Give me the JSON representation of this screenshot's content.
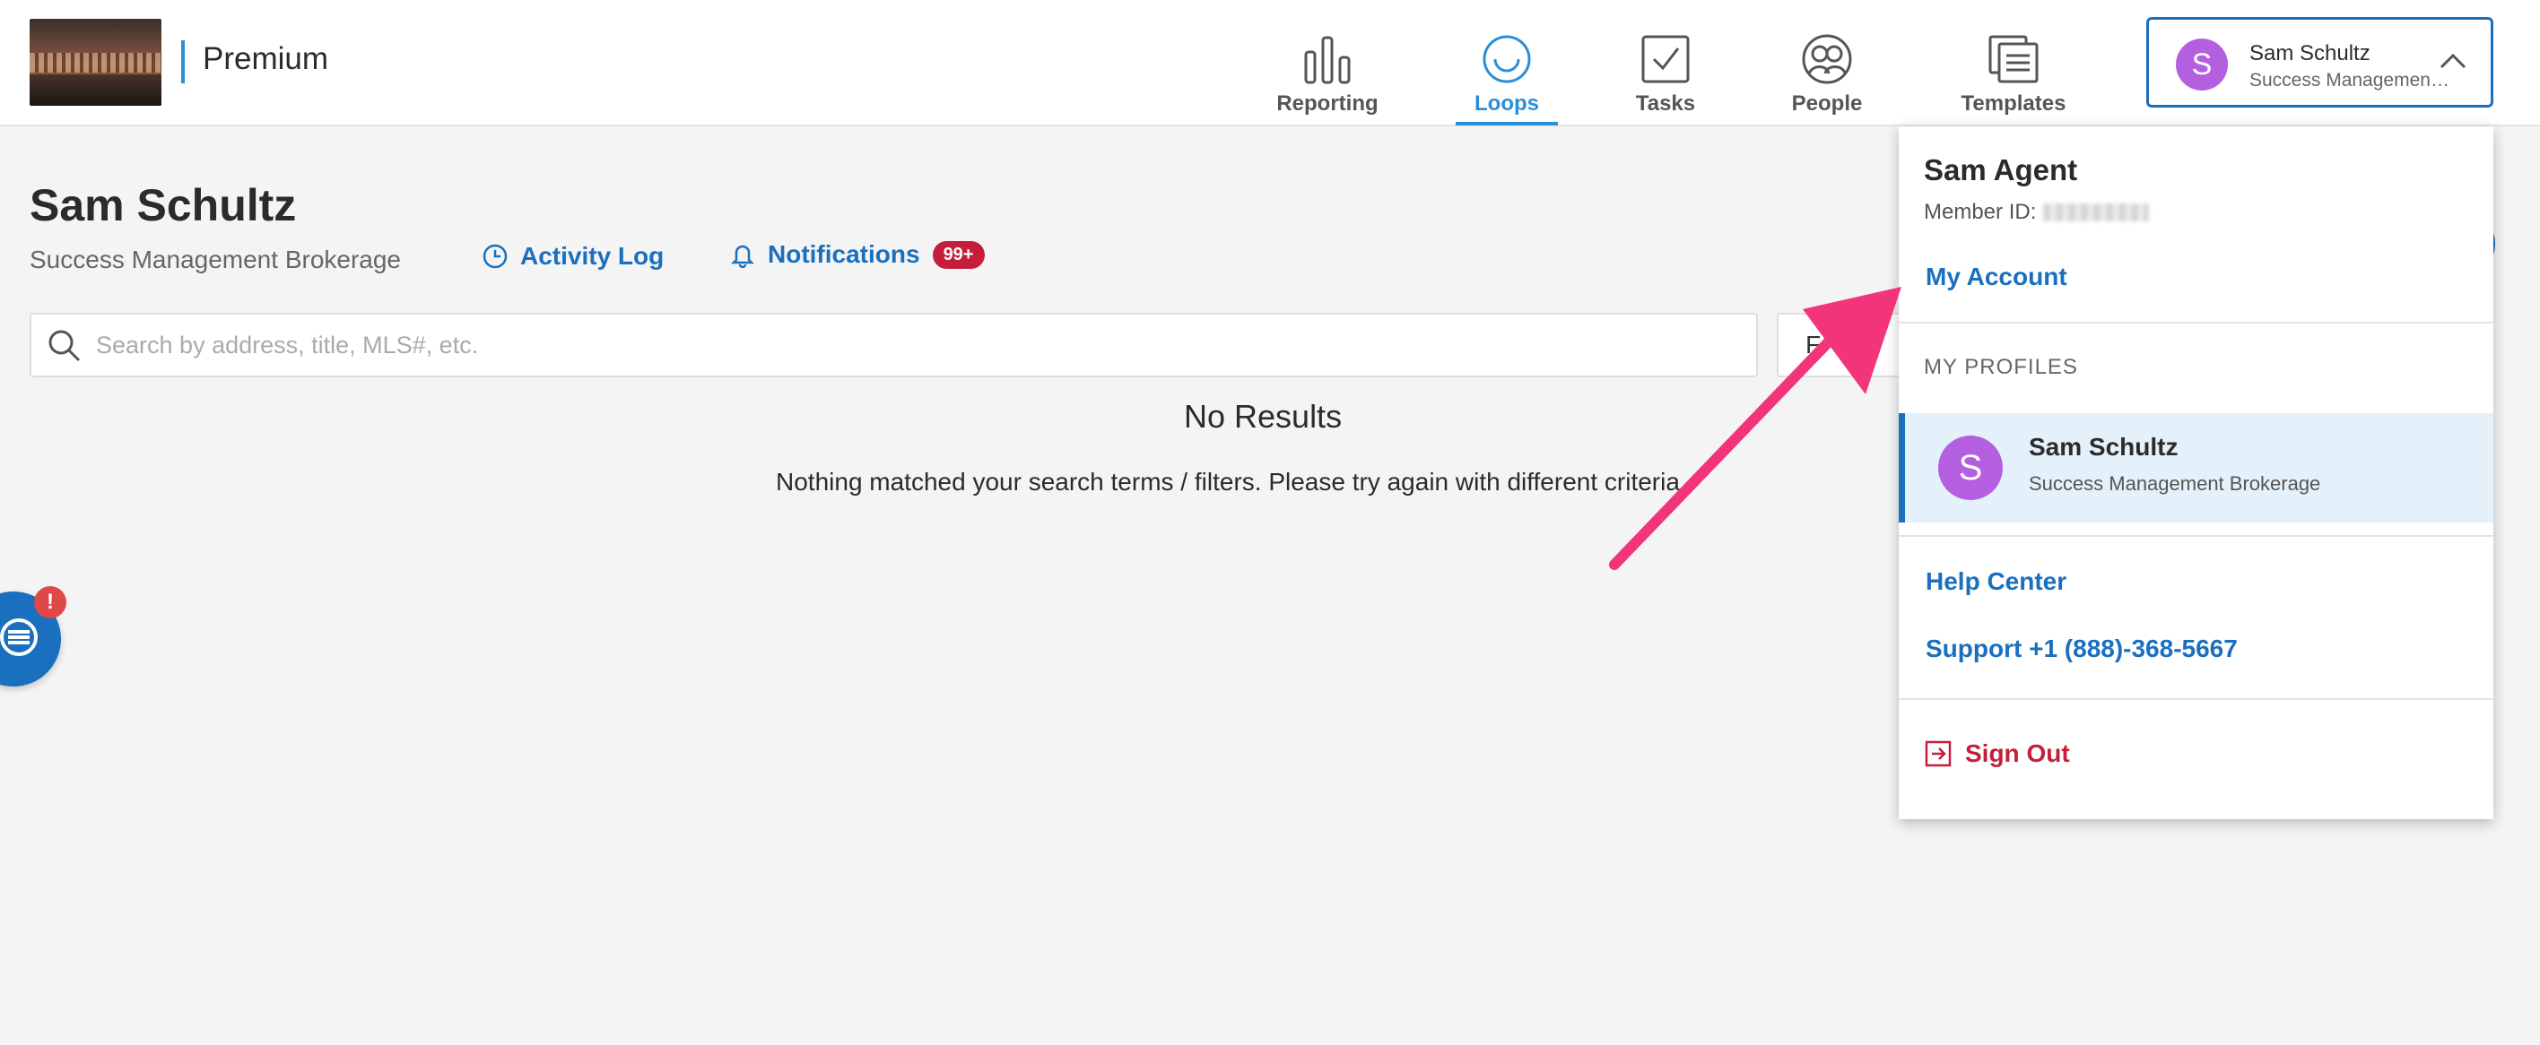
{
  "header": {
    "brand": "Premium",
    "nav": [
      {
        "label": "Reporting",
        "icon": "bar-chart-icon"
      },
      {
        "label": "Loops",
        "icon": "loop-icon",
        "active": true
      },
      {
        "label": "Tasks",
        "icon": "checkbox-icon"
      },
      {
        "label": "People",
        "icon": "people-icon"
      },
      {
        "label": "Templates",
        "icon": "templates-icon"
      }
    ],
    "account": {
      "initial": "S",
      "name": "Sam Schultz",
      "org": "Success Management Brokerage"
    }
  },
  "main": {
    "title": "Sam Schultz",
    "subtitle": "Success Management Brokerage",
    "activity_log": "Activity Log",
    "notifications": "Notifications",
    "notifications_badge": "99+",
    "search_placeholder": "Search by address, title, MLS#, etc.",
    "filter_initial": "F",
    "no_results_title": "No Results",
    "no_results_message": "Nothing matched your search terms / filters. Please try again with different criteria."
  },
  "chat": {
    "badge": "!"
  },
  "dropdown": {
    "name": "Sam Agent",
    "member_label": "Member ID:",
    "my_account": "My Account",
    "profiles_heading": "MY PROFILES",
    "profile": {
      "initial": "S",
      "name": "Sam Schultz",
      "org": "Success Management Brokerage"
    },
    "help_center": "Help Center",
    "support": "Support +1 (888)-368-5667",
    "sign_out": "Sign Out"
  },
  "colors": {
    "accent": "#1a6fbf",
    "nav_active": "#2a8fd8",
    "avatar": "#b45fe0",
    "danger": "#c41e3a",
    "annotation_arrow": "#f2357a"
  }
}
